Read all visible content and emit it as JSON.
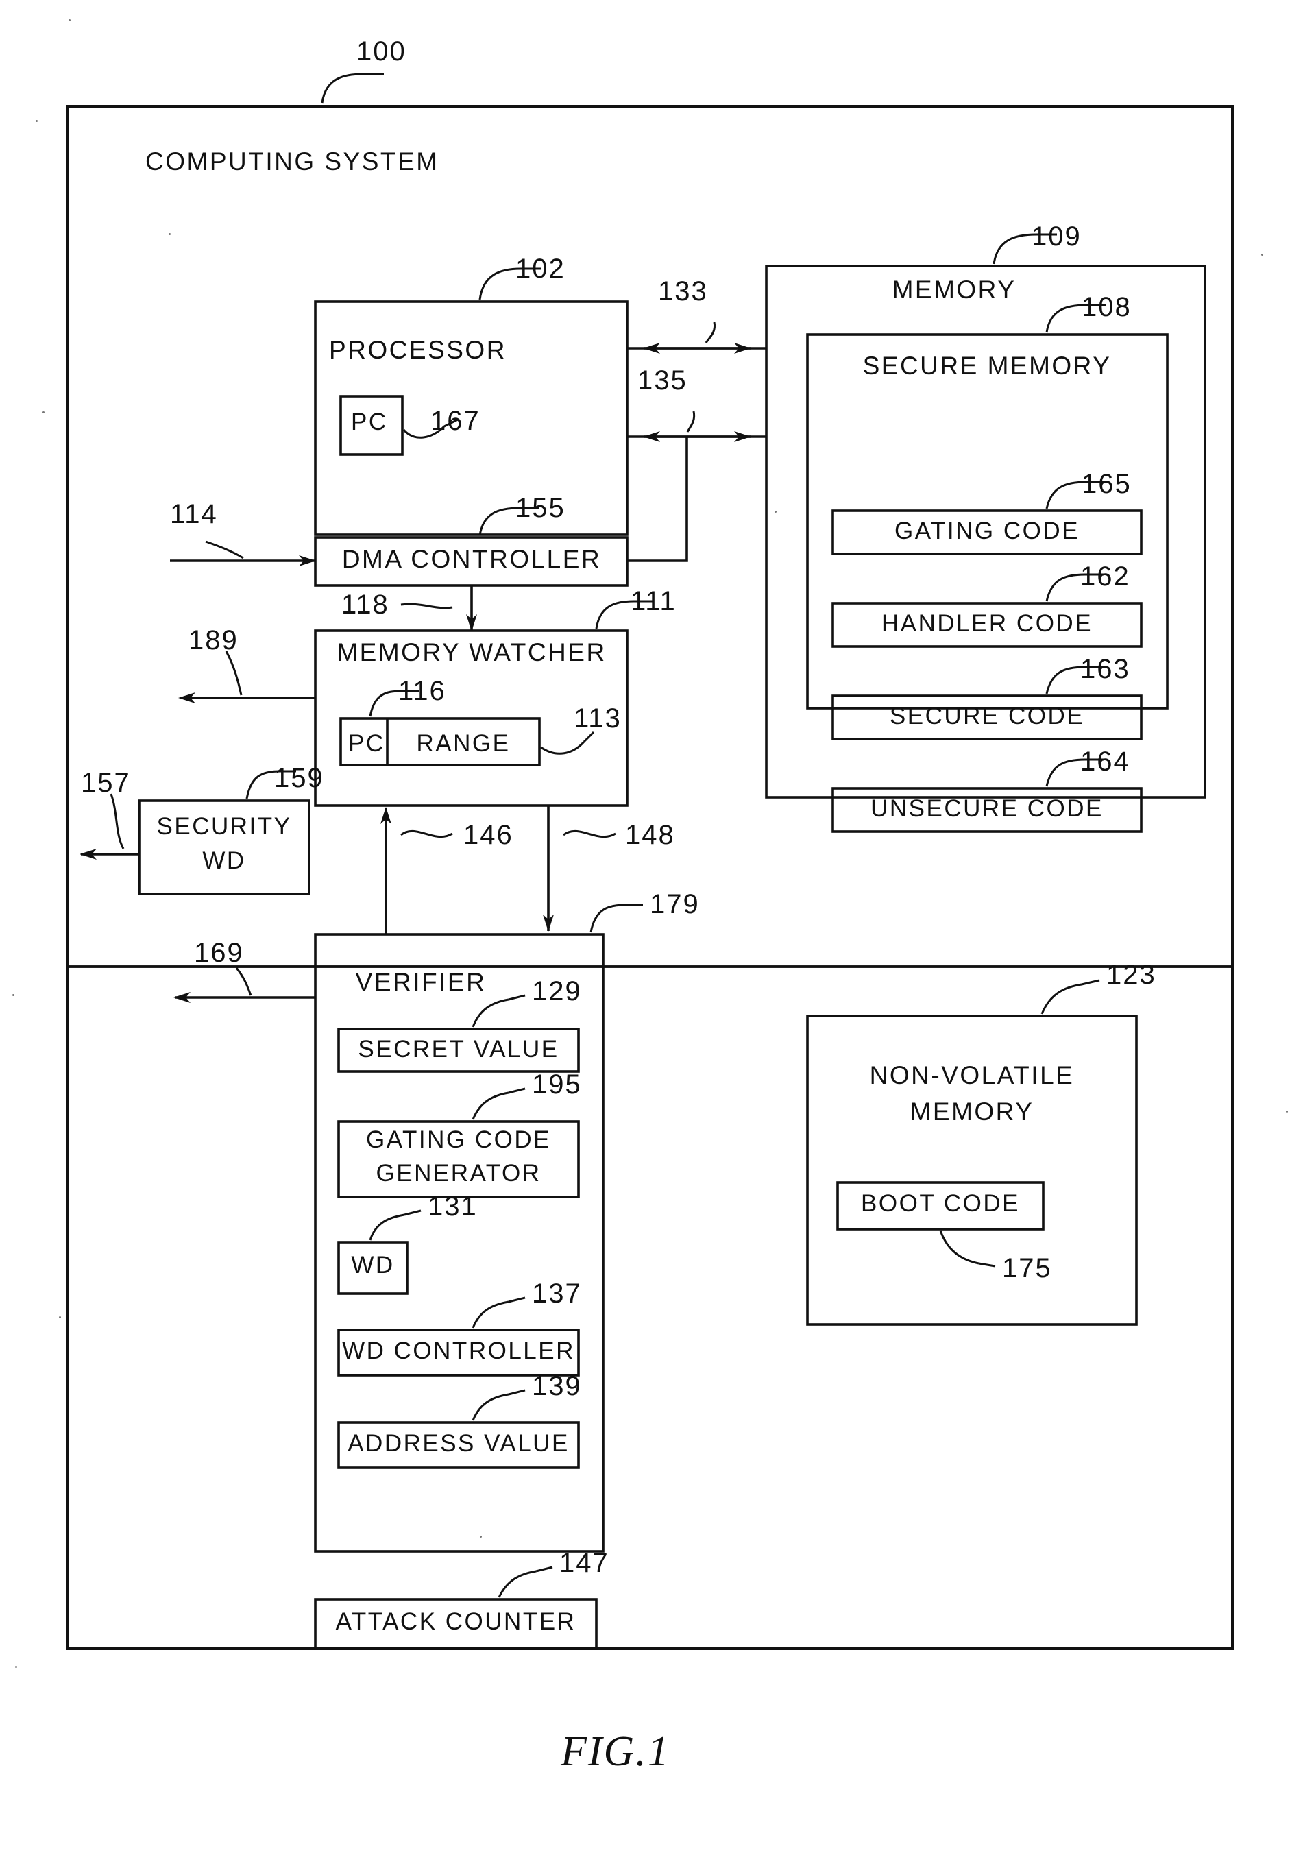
{
  "figure": {
    "caption": "FIG.1",
    "system_title": "COMPUTING SYSTEM",
    "system_ref": "100"
  },
  "blocks": {
    "processor": {
      "label": "PROCESSOR",
      "ref": "102"
    },
    "pc_register": {
      "label": "PC",
      "ref": "167"
    },
    "memory": {
      "label": "MEMORY",
      "ref": "109"
    },
    "secure_memory": {
      "label": "SECURE MEMORY",
      "ref": "108"
    },
    "gating_code": {
      "label": "GATING CODE",
      "ref": "165"
    },
    "handler_code": {
      "label": "HANDLER CODE",
      "ref": "162"
    },
    "secure_code": {
      "label": "SECURE CODE",
      "ref": "163"
    },
    "unsecure_code": {
      "label": "UNSECURE CODE",
      "ref": "164"
    },
    "dma_controller": {
      "label": "DMA CONTROLLER",
      "ref": "155"
    },
    "memory_watcher": {
      "label": "MEMORY WATCHER",
      "ref": "111"
    },
    "watcher_pc": {
      "label": "PC",
      "ref": "116"
    },
    "watcher_range": {
      "label": "RANGE",
      "ref": "113"
    },
    "security_wd": {
      "label_line1": "SECURITY",
      "label_line2": "WD",
      "ref": "159"
    },
    "verifier": {
      "label": "VERIFIER",
      "ref": "179"
    },
    "secret_value": {
      "label": "SECRET VALUE",
      "ref": "129"
    },
    "gating_code_generator": {
      "label_line1": "GATING CODE",
      "label_line2": "GENERATOR",
      "ref": "195"
    },
    "wd": {
      "label": "WD",
      "ref": "131"
    },
    "wd_controller": {
      "label": "WD CONTROLLER",
      "ref": "137"
    },
    "address_value": {
      "label": "ADDRESS VALUE",
      "ref": "139"
    },
    "attack_counter": {
      "label": "ATTACK COUNTER",
      "ref": "147"
    },
    "non_volatile_memory": {
      "label_line1": "NON-VOLATILE",
      "label_line2": "MEMORY",
      "ref": "123"
    },
    "boot_code": {
      "label": "BOOT CODE",
      "ref": "175"
    }
  },
  "connectors": {
    "proc_mem_bus_upper": "133",
    "proc_mem_bus_lower": "135",
    "dma_input": "114",
    "dma_to_watcher": "118",
    "watcher_output": "189",
    "security_wd_output": "157",
    "watcher_to_verifier_up": "146",
    "watcher_to_verifier_down": "148",
    "verifier_output": "169"
  }
}
